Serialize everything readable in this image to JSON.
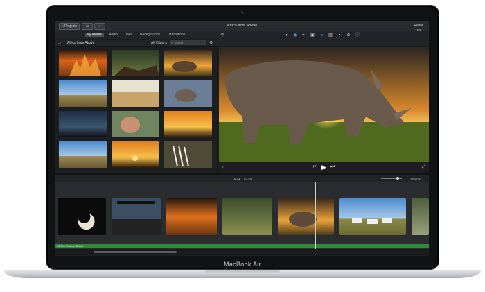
{
  "toolbar": {
    "projects_label": "< Projects",
    "title": "Africa from Above",
    "reset_all": "Reset All"
  },
  "tabs": [
    "My Media",
    "Audio",
    "Titles",
    "Backgrounds",
    "Transitions"
  ],
  "browser": {
    "event_name": "Africa from Above",
    "filter": "All Clips ◇",
    "search_placeholder": "Search"
  },
  "viewer": {
    "timecode": "0:11",
    "duration": "/ 0:45"
  },
  "timeline": {
    "settings_label": "Settings",
    "audio_clip_label": "45.7s – African Safari"
  },
  "device": {
    "label": "MacBook Air"
  },
  "colors": {
    "accent_blue": "#4aa3ff",
    "audio_green": "#2f8a3c"
  }
}
